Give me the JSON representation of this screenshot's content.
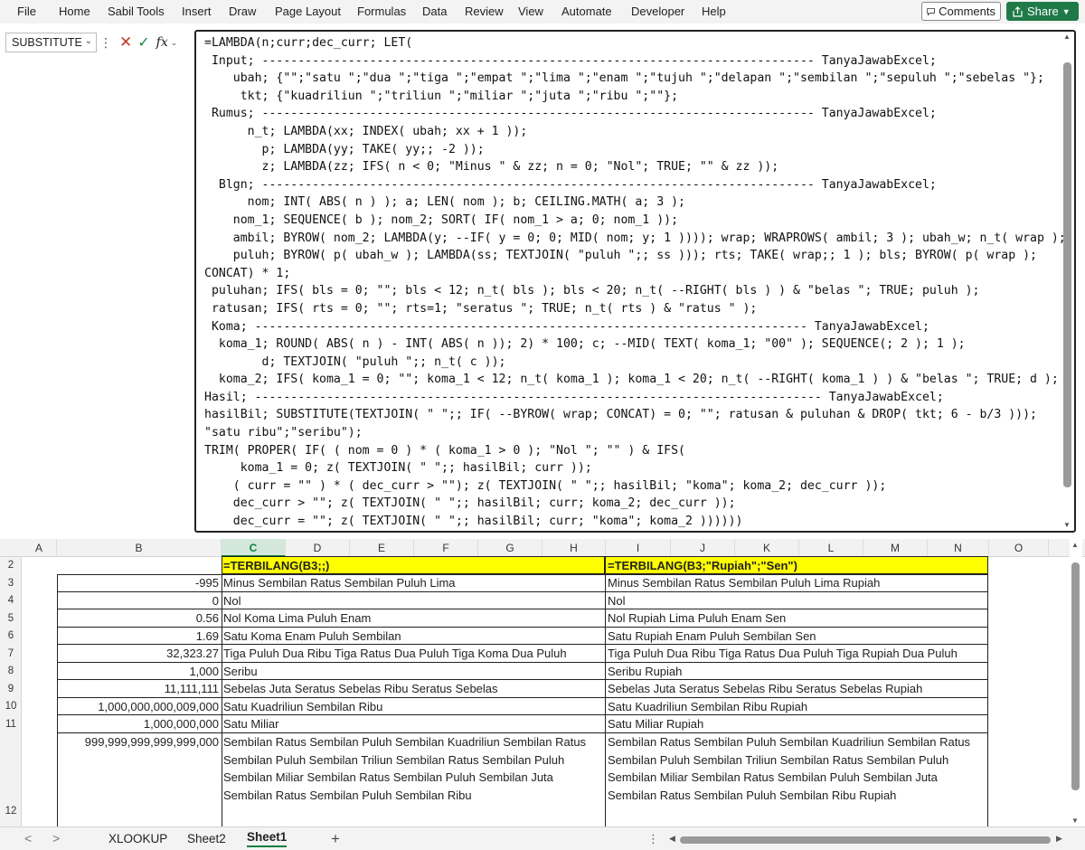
{
  "ribbon": {
    "menu": [
      "File",
      "Home",
      "Sabil Tools",
      "Insert",
      "Draw",
      "Page Layout",
      "Formulas",
      "Data",
      "Review",
      "View",
      "Automate",
      "Developer",
      "Help"
    ],
    "comments": "Comments",
    "share": "Share"
  },
  "formula_bar": {
    "name_box": "SUBSTITUTE",
    "fx": "fx",
    "lines": [
      "=LAMBDA(n;curr;dec_curr; LET(",
      " Input; ----------------------------------------------------------------------------- TanyaJawabExcel;",
      "    ubah; {\"\";\"satu \";\"dua \";\"tiga \";\"empat \";\"lima \";\"enam \";\"tujuh \";\"delapan \";\"sembilan \";\"sepuluh \";\"sebelas \"};",
      "     tkt; {\"kuadriliun \";\"triliun \";\"miliar \";\"juta \";\"ribu \";\"\"};",
      " Rumus; ----------------------------------------------------------------------------- TanyaJawabExcel;",
      "      n_t; LAMBDA(xx; INDEX( ubah; xx + 1 ));",
      "        p; LAMBDA(yy; TAKE( yy;; -2 ));",
      "        z; LAMBDA(zz; IFS( n < 0; \"Minus \" & zz; n = 0; \"Nol\"; TRUE; \"\" & zz ));",
      "  Blgn; ----------------------------------------------------------------------------- TanyaJawabExcel;",
      "      nom; INT( ABS( n ) ); a; LEN( nom ); b; CEILING.MATH( a; 3 );",
      "    nom_1; SEQUENCE( b ); nom_2; SORT( IF( nom_1 > a; 0; nom_1 ));",
      "    ambil; BYROW( nom_2; LAMBDA(y; --IF( y = 0; 0; MID( nom; y; 1 )))); wrap; WRAPROWS( ambil; 3 ); ubah_w; n_t( wrap );",
      "    puluh; BYROW( p( ubah_w ); LAMBDA(ss; TEXTJOIN( \"puluh \";; ss ))); rts; TAKE( wrap;; 1 ); bls; BYROW( p( wrap );",
      "CONCAT) * 1;",
      " puluhan; IFS( bls = 0; \"\"; bls < 12; n_t( bls ); bls < 20; n_t( --RIGHT( bls ) ) & \"belas \"; TRUE; puluh );",
      " ratusan; IFS( rts = 0; \"\"; rts=1; \"seratus \"; TRUE; n_t( rts ) & \"ratus \" );",
      " Koma; ----------------------------------------------------------------------------- TanyaJawabExcel;",
      "  koma_1; ROUND( ABS( n ) - INT( ABS( n )); 2) * 100; c; --MID( TEXT( koma_1; \"00\" ); SEQUENCE(; 2 ); 1 );",
      "        d; TEXTJOIN( \"puluh \";; n_t( c ));",
      "  koma_2; IFS( koma_1 = 0; \"\"; koma_1 < 12; n_t( koma_1 ); koma_1 < 20; n_t( --RIGHT( koma_1 ) ) & \"belas \"; TRUE; d );",
      "Hasil; ------------------------------------------------------------------------------- TanyaJawabExcel;",
      "hasilBil; SUBSTITUTE(TEXTJOIN( \" \";; IF( --BYROW( wrap; CONCAT) = 0; \"\"; ratusan & puluhan & DROP( tkt; 6 - b/3 )));",
      "\"satu ribu\";\"seribu\");",
      "TRIM( PROPER( IF( ( nom = 0 ) * ( koma_1 > 0 ); \"Nol \"; \"\" ) & IFS(",
      "     koma_1 = 0; z( TEXTJOIN( \" \";; hasilBil; curr ));",
      "    ( curr = \"\" ) * ( dec_curr > \"\"); z( TEXTJOIN( \" \";; hasilBil; \"koma\"; koma_2; dec_curr ));",
      "    dec_curr > \"\"; z( TEXTJOIN( \" \";; hasilBil; curr; koma_2; dec_curr ));",
      "    dec_curr = \"\"; z( TEXTJOIN( \" \";; hasilBil; curr; \"koma\"; koma_2 ))))))"
    ]
  },
  "grid": {
    "columns": [
      "A",
      "B",
      "C",
      "D",
      "E",
      "F",
      "G",
      "H",
      "I",
      "J",
      "K",
      "L",
      "M",
      "N",
      "O"
    ],
    "selected_column": "C",
    "row_numbers": [
      "2",
      "3",
      "4",
      "5",
      "6",
      "7",
      "8",
      "9",
      "10",
      "11",
      "12"
    ],
    "header_c": "=TERBILANG(B3;;)",
    "header_i": "=TERBILANG(B3;\"Rupiah\";\"Sen\")",
    "rows": [
      {
        "num": "-995",
        "c": "Minus Sembilan Ratus Sembilan Puluh Lima",
        "i": "Minus Sembilan Ratus Sembilan Puluh Lima Rupiah"
      },
      {
        "num": "0",
        "c": "Nol",
        "i": "Nol"
      },
      {
        "num": "0.56",
        "c": "Nol Koma Lima Puluh Enam",
        "i": "Nol Rupiah Lima Puluh Enam Sen"
      },
      {
        "num": "1.69",
        "c": "Satu Koma Enam Puluh Sembilan",
        "i": "Satu Rupiah Enam Puluh Sembilan Sen"
      },
      {
        "num": "32,323.27",
        "c": "Tiga Puluh Dua Ribu Tiga Ratus Dua Puluh Tiga Koma Dua Puluh",
        "i": "Tiga Puluh Dua Ribu Tiga Ratus Dua Puluh Tiga Rupiah Dua Puluh"
      },
      {
        "num": "1,000",
        "c": "Seribu",
        "i": "Seribu Rupiah"
      },
      {
        "num": "11,111,111",
        "c": "Sebelas Juta Seratus Sebelas Ribu Seratus Sebelas",
        "i": "Sebelas Juta Seratus Sebelas Ribu Seratus Sebelas Rupiah"
      },
      {
        "num": "1,000,000,000,009,000",
        "c": "Satu Kuadriliun Sembilan Ribu",
        "i": "Satu Kuadriliun Sembilan Ribu Rupiah"
      },
      {
        "num": "1,000,000,000",
        "c": "Satu Miliar",
        "i": "Satu Miliar Rupiah"
      }
    ],
    "last_row": {
      "num": "999,999,999,999,999,000",
      "c_lines": [
        "Sembilan Ratus Sembilan Puluh Sembilan Kuadriliun Sembilan Ratus",
        "Sembilan Puluh Sembilan Triliun Sembilan Ratus Sembilan Puluh",
        "Sembilan Miliar Sembilan Ratus Sembilan Puluh Sembilan Juta",
        "Sembilan Ratus Sembilan Puluh Sembilan Ribu"
      ],
      "i_lines": [
        "Sembilan Ratus Sembilan Puluh Sembilan Kuadriliun Sembilan Ratus",
        "Sembilan Puluh Sembilan Triliun Sembilan Ratus Sembilan Puluh",
        "Sembilan Miliar Sembilan Ratus Sembilan Puluh Sembilan Juta",
        "Sembilan Ratus Sembilan Puluh Sembilan Ribu Rupiah"
      ]
    }
  },
  "tabs": {
    "sheets": [
      "XLOOKUP",
      "Sheet2",
      "Sheet1"
    ],
    "active": "Sheet1",
    "add": "+"
  }
}
